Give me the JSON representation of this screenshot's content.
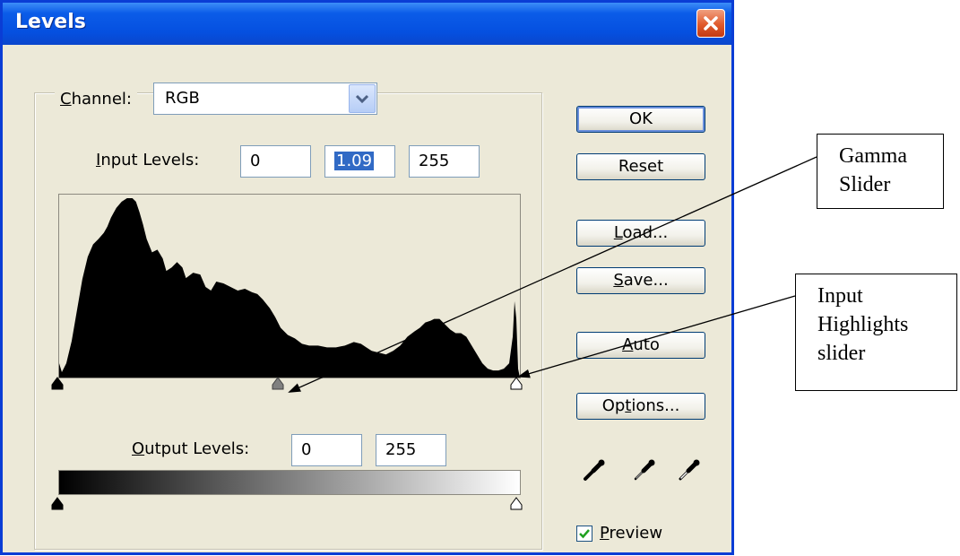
{
  "window": {
    "title": "Levels",
    "colors": {
      "titlebar": "#0550e0",
      "face": "#ece9d8",
      "close": "#e05a2c",
      "selection": "#316ac5"
    }
  },
  "channel": {
    "label_prefix": "",
    "label_mnemonic": "C",
    "label_rest": "hannel:",
    "value": "RGB"
  },
  "input_levels": {
    "label_mnemonic": "I",
    "label_rest": "nput Levels:",
    "shadows": "0",
    "gamma": "1.09",
    "highlights": "255"
  },
  "output_levels": {
    "label_mnemonic": "O",
    "label_rest": "utput Levels:",
    "shadows": "0",
    "highlights": "255"
  },
  "buttons": {
    "ok": "OK",
    "reset": "Reset",
    "load_mnemonic": "L",
    "load_rest": "oad...",
    "save_mnemonic": "S",
    "save_rest": "ave...",
    "auto_mnemonic": "A",
    "auto_rest": "uto",
    "options_pre": "Op",
    "options_mnemonic": "t",
    "options_rest": "ions..."
  },
  "preview": {
    "checked": true,
    "label_mnemonic": "P",
    "label_rest": "review"
  },
  "eyedroppers": [
    "black-eyedropper-icon",
    "gray-eyedropper-icon",
    "white-eyedropper-icon"
  ],
  "annotations": {
    "gamma_note": [
      "Gamma",
      "Slider"
    ],
    "highlights_note": [
      "Input",
      "Highlights",
      "slider"
    ]
  },
  "sliders": {
    "input_shadow_level": 0,
    "input_gamma_level": 1.09,
    "input_highlight_level": 255,
    "output_shadow_level": 0,
    "output_highlight_level": 255
  }
}
